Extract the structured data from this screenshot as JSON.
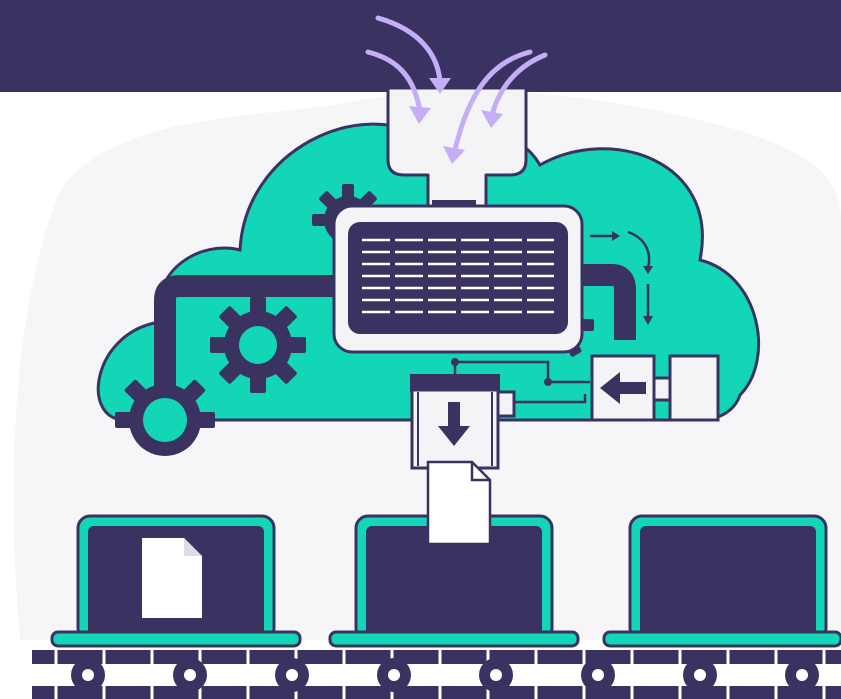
{
  "illustration": {
    "concept": "",
    "colors": {
      "navy": "#3a3362",
      "teal": "#13d6b6",
      "lavender": "#c5aef5",
      "paper": "#ffffff",
      "panel": "#f4f4f7",
      "backdrop": "#f6f6f8"
    },
    "icons": [
      "cloud",
      "gear-icon",
      "printer",
      "funnel-hopper",
      "arrow-left-icon",
      "arrow-down-icon",
      "document-icon",
      "laptop",
      "conveyor-belt"
    ],
    "laptops": [
      {
        "id": "laptop-left",
        "has_document": true
      },
      {
        "id": "laptop-middle",
        "has_document": false
      },
      {
        "id": "laptop-right",
        "has_document": false
      }
    ]
  }
}
